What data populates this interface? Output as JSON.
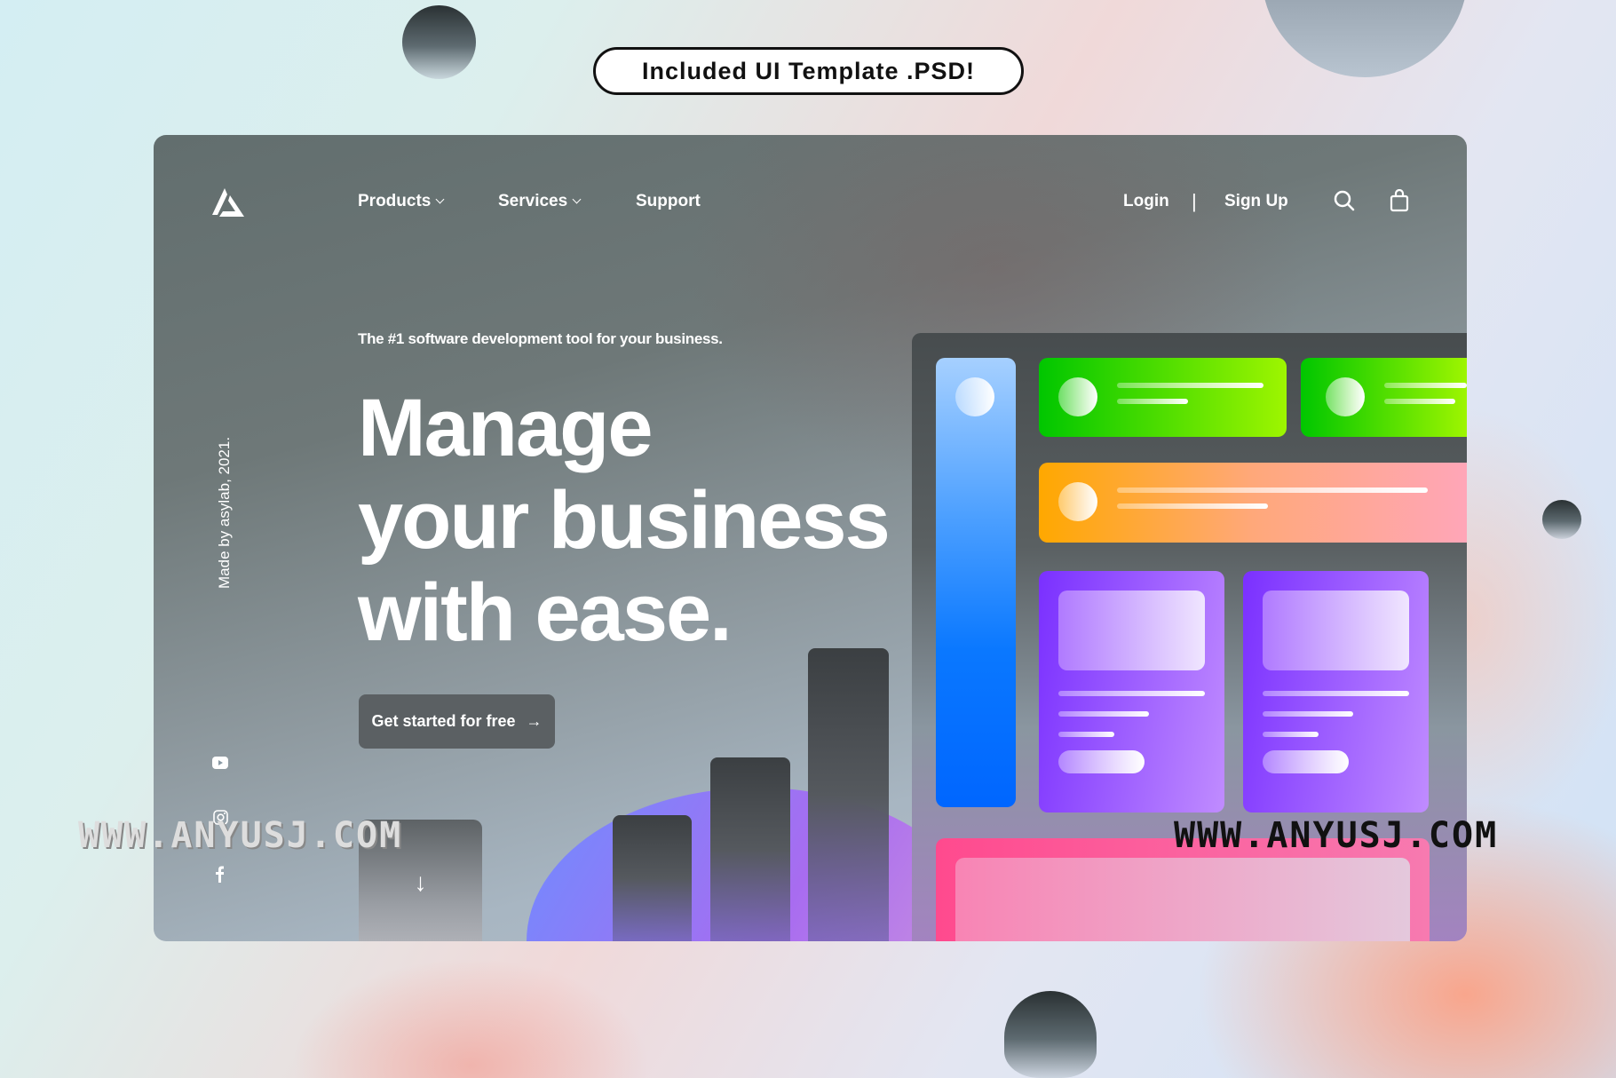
{
  "badge": {
    "label": "Included UI Template .PSD!"
  },
  "nav": {
    "logo": "logo-icon",
    "items": [
      {
        "label": "Products",
        "dropdown": true
      },
      {
        "label": "Services",
        "dropdown": true
      },
      {
        "label": "Support",
        "dropdown": false
      }
    ],
    "login": "Login",
    "separator": "|",
    "signup": "Sign Up",
    "icons": [
      "search-icon",
      "shopping-bag-icon"
    ]
  },
  "hero": {
    "tagline": "The #1 software development tool for your business.",
    "headline": [
      "Manage",
      "your business",
      "with ease."
    ],
    "cta_label": "Get started for free",
    "cta_icon": "arrow-right-icon",
    "credit": "Made by asylab, 2021.",
    "scroll_icon": "arrow-down-icon"
  },
  "social": [
    "youtube-icon",
    "instagram-icon",
    "facebook-icon"
  ],
  "watermarks": [
    "WWW.ANYUSJ.COM",
    "WWW.ANYUSJ.COM"
  ],
  "colors": {
    "green": "#22cc00",
    "orange": "#ffaa00",
    "purple": "#7b33ff",
    "blue": "#0a6cff",
    "pink": "#ff4d8d",
    "button": "#5b6063"
  }
}
